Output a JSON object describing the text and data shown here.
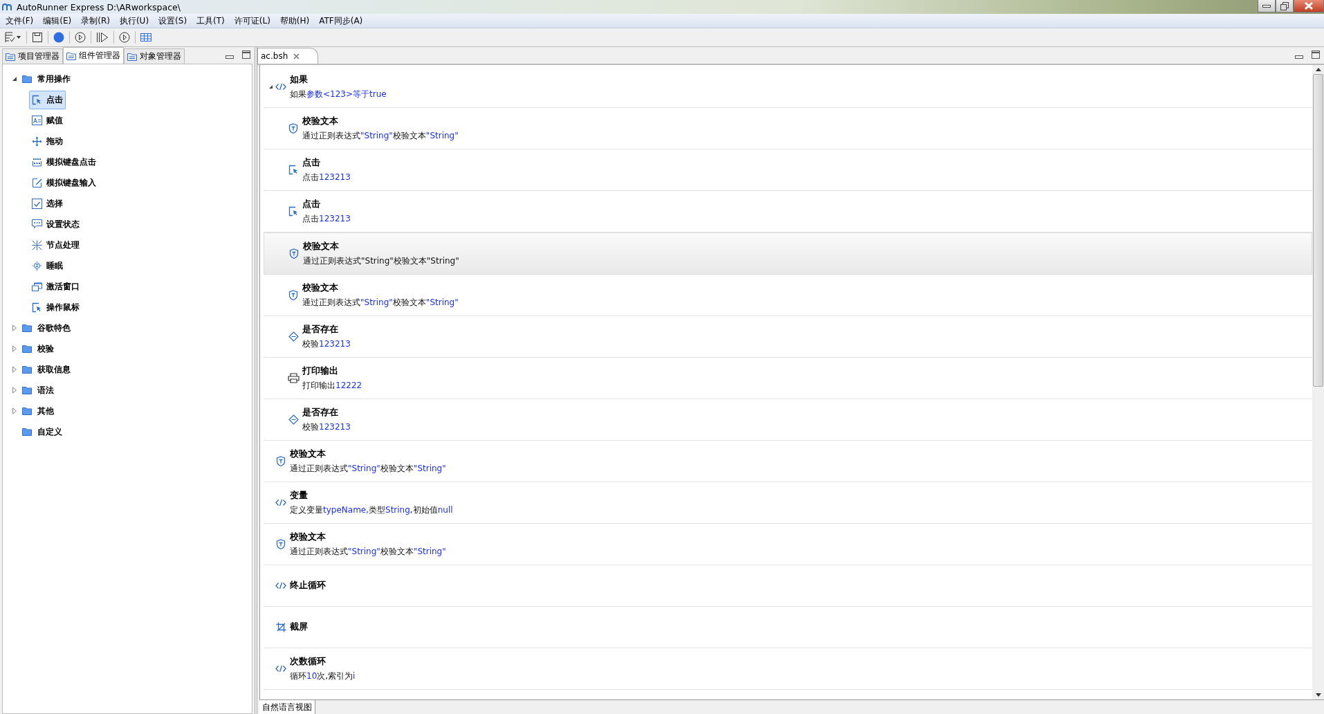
{
  "window": {
    "title": "AutoRunner Express  D:\\ARworkspace\\"
  },
  "menu": [
    "文件(F)",
    "编辑(E)",
    "录制(R)",
    "执行(U)",
    "设置(S)",
    "工具(T)",
    "许可证(L)",
    "帮助(H)",
    "ATF同步(A)"
  ],
  "panel_tabs": [
    {
      "label": "项目管理器",
      "selected": false
    },
    {
      "label": "组件管理器",
      "selected": true
    },
    {
      "label": "对象管理器",
      "selected": false
    }
  ],
  "tree": [
    {
      "label": "常用操作",
      "kind": "folder",
      "expanded": true,
      "selected": false,
      "children": [
        {
          "label": "点击",
          "kind": "click",
          "selected": true
        },
        {
          "label": "赋值",
          "kind": "assign",
          "selected": false
        },
        {
          "label": "拖动",
          "kind": "move",
          "selected": false
        },
        {
          "label": "模拟键盘点击",
          "kind": "keyboard",
          "selected": false
        },
        {
          "label": "模拟键盘输入",
          "kind": "edit",
          "selected": false
        },
        {
          "label": "选择",
          "kind": "check",
          "selected": false
        },
        {
          "label": "设置状态",
          "kind": "status",
          "selected": false
        },
        {
          "label": "节点处理",
          "kind": "node",
          "selected": false
        },
        {
          "label": "睡眠",
          "kind": "sleep",
          "selected": false
        },
        {
          "label": "激活窗口",
          "kind": "window",
          "selected": false
        },
        {
          "label": "操作鼠标",
          "kind": "click",
          "selected": false
        }
      ]
    },
    {
      "label": "谷歌特色",
      "kind": "folder",
      "expanded": false,
      "selected": false
    },
    {
      "label": "校验",
      "kind": "folder",
      "expanded": false,
      "selected": false
    },
    {
      "label": "获取信息",
      "kind": "folder",
      "expanded": false,
      "selected": false
    },
    {
      "label": "语法",
      "kind": "folder",
      "expanded": false,
      "selected": false
    },
    {
      "label": "其他",
      "kind": "folder",
      "expanded": false,
      "selected": false
    },
    {
      "label": "自定义",
      "kind": "folder",
      "selected": false
    }
  ],
  "editor_tab": {
    "label": "ac.bsh"
  },
  "steps": [
    {
      "title": "如果",
      "kind": "code",
      "selected": false,
      "expanded": true,
      "detail": [
        {
          "text": "如果",
          "value": false
        },
        {
          "text": "参数<123>等于true",
          "value": true
        }
      ],
      "children": [
        {
          "title": "校验文本",
          "kind": "shield",
          "selected": false,
          "detail": [
            {
              "text": "通过正则表达式",
              "value": false
            },
            {
              "text": "\"String\"",
              "value": true
            },
            {
              "text": "校验文本",
              "value": false
            },
            {
              "text": "\"String\"",
              "value": true
            }
          ]
        },
        {
          "title": "点击",
          "kind": "click",
          "selected": false,
          "detail": [
            {
              "text": "点击",
              "value": false
            },
            {
              "text": "123213",
              "value": true
            }
          ]
        },
        {
          "title": "点击",
          "kind": "click",
          "selected": false,
          "detail": [
            {
              "text": "点击",
              "value": false
            },
            {
              "text": "123213",
              "value": true
            }
          ]
        },
        {
          "title": "校验文本",
          "kind": "shield",
          "selected": true,
          "detail": [
            {
              "text": "通过正则表达式\"String\"校验文本\"String\"",
              "value": false
            }
          ]
        },
        {
          "title": "校验文本",
          "kind": "shield",
          "selected": false,
          "detail": [
            {
              "text": "通过正则表达式",
              "value": false
            },
            {
              "text": "\"String\"",
              "value": true
            },
            {
              "text": "校验文本",
              "value": false
            },
            {
              "text": "\"String\"",
              "value": true
            }
          ]
        },
        {
          "title": "是否存在",
          "kind": "diamond",
          "selected": false,
          "detail": [
            {
              "text": "校验",
              "value": false
            },
            {
              "text": "123213",
              "value": true
            }
          ]
        },
        {
          "title": "打印输出",
          "kind": "printer",
          "selected": false,
          "detail": [
            {
              "text": "打印输出",
              "value": false
            },
            {
              "text": "12222",
              "value": true
            }
          ]
        },
        {
          "title": "是否存在",
          "kind": "diamond",
          "selected": false,
          "detail": [
            {
              "text": "校验",
              "value": false
            },
            {
              "text": "123213",
              "value": true
            }
          ]
        }
      ]
    },
    {
      "title": "校验文本",
      "kind": "shield",
      "selected": false,
      "detail": [
        {
          "text": "通过正则表达式",
          "value": false
        },
        {
          "text": "\"String\"",
          "value": true
        },
        {
          "text": "校验文本",
          "value": false
        },
        {
          "text": "\"String\"",
          "value": true
        }
      ]
    },
    {
      "title": "变量",
      "kind": "code",
      "selected": false,
      "detail": [
        {
          "text": "定义变量",
          "value": false
        },
        {
          "text": "typeName,",
          "value": true
        },
        {
          "text": "类型",
          "value": false
        },
        {
          "text": "String",
          "value": true
        },
        {
          "text": ",初始值",
          "value": false
        },
        {
          "text": "null",
          "value": true
        }
      ]
    },
    {
      "title": "校验文本",
      "kind": "shield",
      "selected": false,
      "detail": [
        {
          "text": "通过正则表达式",
          "value": false
        },
        {
          "text": "\"String\"",
          "value": true
        },
        {
          "text": "校验文本",
          "value": false
        },
        {
          "text": "\"String\"",
          "value": true
        }
      ]
    },
    {
      "title": "终止循环",
      "kind": "code",
      "selected": false
    },
    {
      "title": "截屏",
      "kind": "crop",
      "selected": false
    },
    {
      "title": "次数循环",
      "kind": "code",
      "selected": false,
      "detail": [
        {
          "text": "循环",
          "value": false
        },
        {
          "text": "10",
          "value": true
        },
        {
          "text": "次,索引为",
          "value": false
        },
        {
          "text": "i",
          "value": true
        }
      ]
    }
  ],
  "bottom_tab": {
    "label": "自然语言视图"
  }
}
